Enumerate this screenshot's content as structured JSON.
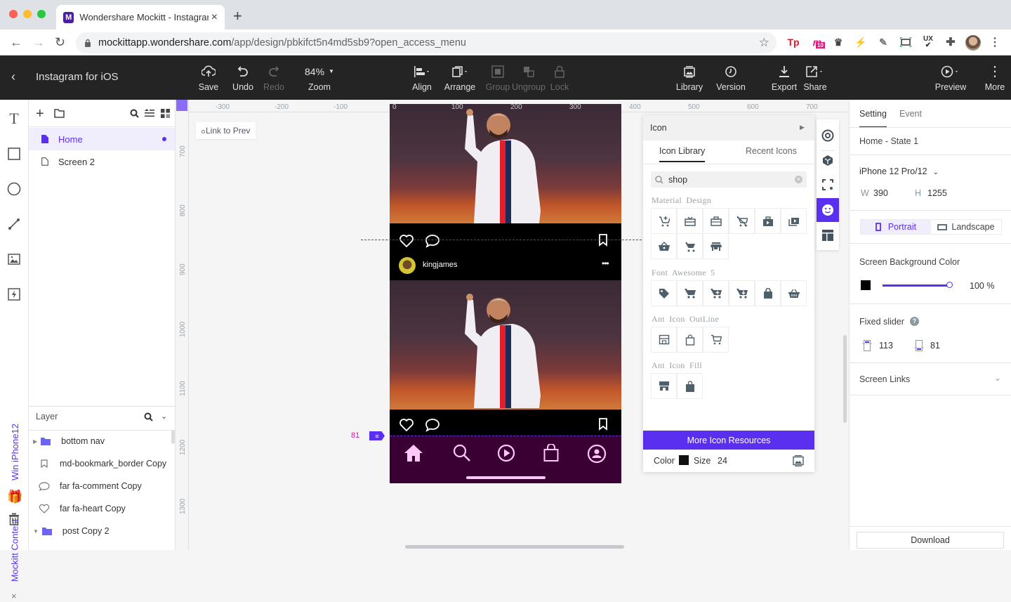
{
  "browser": {
    "tab_title": "Wondershare Mockitt - Instagram for iOS",
    "tab_favicon": "M",
    "url_host": "mockittapp.wondershare.com",
    "url_path": "/app/design/pbkifct5n4md5sb9?open_access_menu",
    "extensions": [
      {
        "name": "tp-extension-icon",
        "label": "Tp",
        "color": "#e0192b"
      },
      {
        "name": "mockitt-extension-icon",
        "label": "m",
        "badge": "10",
        "color": "#e0197d"
      },
      {
        "name": "crown-extension-icon",
        "label": "♛",
        "color": "#444"
      },
      {
        "name": "runner-extension-icon",
        "label": "⚡",
        "color": "#1ccf9d"
      },
      {
        "name": "eyedropper-extension-icon",
        "label": "✎",
        "color": "#777"
      },
      {
        "name": "screenshot-extension-icon",
        "label": "▭",
        "color": "#333"
      },
      {
        "name": "ux-check-extension-icon",
        "label": "UX",
        "color": "#222"
      },
      {
        "name": "puzzle-extension-icon",
        "label": "✚",
        "color": "#555"
      }
    ]
  },
  "app": {
    "project_title": "Instagram for iOS",
    "toolbar": {
      "save": "Save",
      "undo": "Undo",
      "redo": "Redo",
      "zoom_value": "84%",
      "zoom_label": "Zoom",
      "align": "Align",
      "arrange": "Arrange",
      "group": "Group",
      "ungroup": "Ungroup",
      "lock": "Lock",
      "library": "Library",
      "version": "Version",
      "export": "Export",
      "share": "Share",
      "preview": "Preview",
      "more": "More"
    }
  },
  "pages": {
    "items": [
      {
        "label": "Home",
        "active": true
      },
      {
        "label": "Screen 2",
        "active": false
      }
    ]
  },
  "contest_banner": {
    "text1": "Win iPhone12",
    "text2": "Mockitt Contest"
  },
  "layers": {
    "title": "Layer",
    "items": [
      {
        "label": "bottom nav",
        "type": "folder"
      },
      {
        "label": "md-bookmark_border Copy",
        "type": "bookmark"
      },
      {
        "label": "far fa-comment Copy",
        "type": "comment"
      },
      {
        "label": "far fa-heart Copy",
        "type": "heart"
      },
      {
        "label": "post Copy 2",
        "type": "folder"
      }
    ]
  },
  "canvas": {
    "link_to_prev": "Link to Prev",
    "h_ruler": [
      "-300",
      "-200",
      "-100",
      "0",
      "100",
      "200",
      "300",
      "400",
      "500",
      "600",
      "700"
    ],
    "v_ruler": [
      "700",
      "800",
      "900",
      "1000",
      "1100",
      "1200",
      "1300"
    ],
    "fixed_bottom_marker": "81",
    "post": {
      "username": "kingjames"
    },
    "accent": "#5b2ff0"
  },
  "icon_panel": {
    "title": "Icon",
    "tabs": [
      "Icon Library",
      "Recent Icons"
    ],
    "active_tab": "Icon Library",
    "search_value": "shop",
    "sections": [
      {
        "title": "Material Design",
        "icons": [
          "add-shopping-cart",
          "redeem",
          "work-outline",
          "remove-shopping-cart",
          "shop",
          "shop-two",
          "shopping-basket",
          "shopping-cart",
          "store"
        ]
      },
      {
        "title": "Font Awesome 5",
        "icons": [
          "tag",
          "shopping-cart",
          "cart-plus",
          "cart-arrow-down",
          "shopping-bag",
          "basket"
        ]
      },
      {
        "title": "Ant Icon OutLine",
        "icons": [
          "shop-outline",
          "shopping-outline",
          "shopping-cart-outline"
        ]
      },
      {
        "title": "Ant Icon Fill",
        "icons": [
          "shop-fill",
          "shopping-fill"
        ]
      }
    ],
    "more_button": "More Icon Resources",
    "color_label": "Color",
    "color_value": "#111111",
    "size_label": "Size",
    "size_value": "24"
  },
  "settings": {
    "tabs": [
      "Setting",
      "Event"
    ],
    "active_tab": "Setting",
    "state": "Home - State 1",
    "device": "iPhone 12 Pro/12",
    "w_label": "W",
    "w_value": "390",
    "h_label": "H",
    "h_value": "1255",
    "orientation": [
      "Portrait",
      "Landscape"
    ],
    "active_orientation": "Portrait",
    "bg_color_label": "Screen Background Color",
    "bg_color": "#000000",
    "bg_opacity": "100 %",
    "bg_opacity_fraction": 1.0,
    "fixed_slider_label": "Fixed slider",
    "fixed_top": "113",
    "fixed_bottom": "81",
    "screen_links": "Screen Links",
    "download": "Download"
  }
}
